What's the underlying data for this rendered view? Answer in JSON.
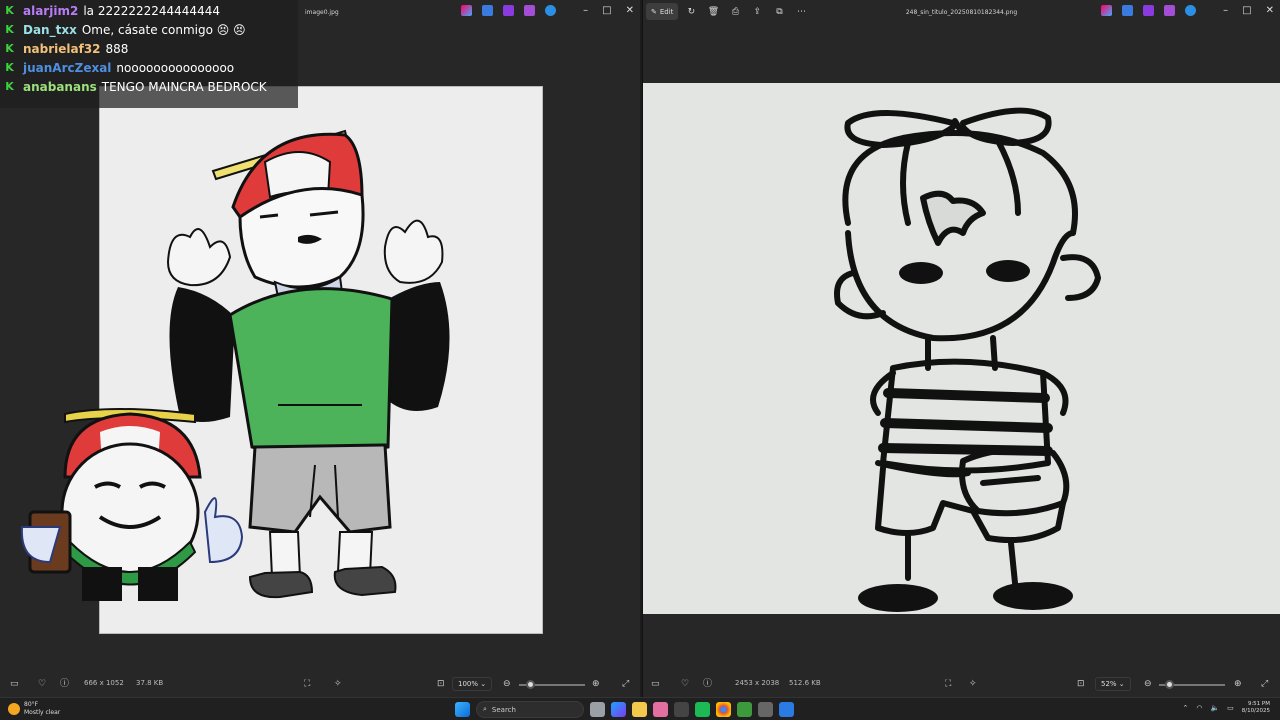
{
  "left_window": {
    "title": "image0.jpg",
    "status": {
      "dimensions": "666 x 1052",
      "size": "37.8 KB",
      "zoom": "100%"
    }
  },
  "right_window": {
    "edit_label": "Edit",
    "title": "248_sin_titulo_20250810182344.png",
    "status": {
      "dimensions": "2453 x 2038",
      "size": "512.6 KB",
      "zoom": "52%"
    }
  },
  "chat": {
    "messages": [
      {
        "user": "alarjim2",
        "color": "#b97cf6",
        "text": "la 2222222244444444"
      },
      {
        "user": "Dan_txx",
        "color": "#9ae0e6",
        "text": "Ome, cásate conmigo 😣 😣"
      },
      {
        "user": "nabrielaf32",
        "color": "#f2c07a",
        "text": "888"
      },
      {
        "user": "juanArcZexal",
        "color": "#4f8fe0",
        "text": "nooooooooooooooo"
      },
      {
        "user": "anabanans",
        "color": "#9be07a",
        "text": "TENGO MAINCRA BEDROCK"
      }
    ]
  },
  "taskbar": {
    "weather_temp": "80°F",
    "weather_desc": "Mostly clear",
    "search_placeholder": "Search",
    "time": "9:51 PM",
    "date": "8/10/2025"
  }
}
